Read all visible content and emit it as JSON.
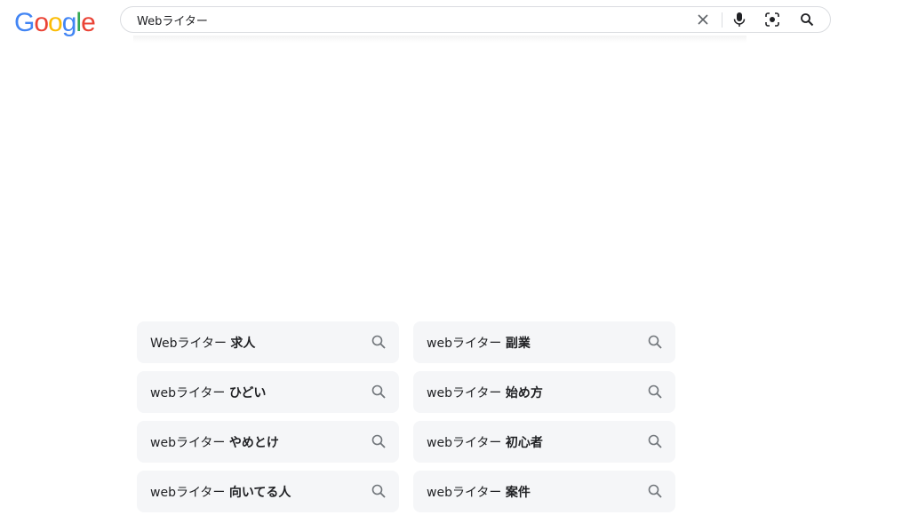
{
  "logo": {
    "letters": [
      "G",
      "o",
      "o",
      "g",
      "l",
      "e"
    ],
    "colors": [
      "#4285F4",
      "#EA4335",
      "#FBBC05",
      "#4285F4",
      "#34A853",
      "#EA4335"
    ]
  },
  "search": {
    "value": "Webライター",
    "icons": [
      "clear-icon",
      "microphone-icon",
      "lens-icon",
      "search-icon"
    ]
  },
  "related_searches": [
    {
      "base": "Webライター ",
      "suffix": "求人"
    },
    {
      "base": "webライター ",
      "suffix": "副業"
    },
    {
      "base": "webライター ",
      "suffix": "ひどい"
    },
    {
      "base": "webライター ",
      "suffix": "始め方"
    },
    {
      "base": "webライター ",
      "suffix": "やめとけ"
    },
    {
      "base": "webライター ",
      "suffix": "初心者"
    },
    {
      "base": "webライター ",
      "suffix": "向いてる人"
    },
    {
      "base": "webライター ",
      "suffix": "案件"
    }
  ],
  "colors": {
    "chip_bg": "#f5f6f8",
    "text": "#202124",
    "icon": "#70757a"
  }
}
